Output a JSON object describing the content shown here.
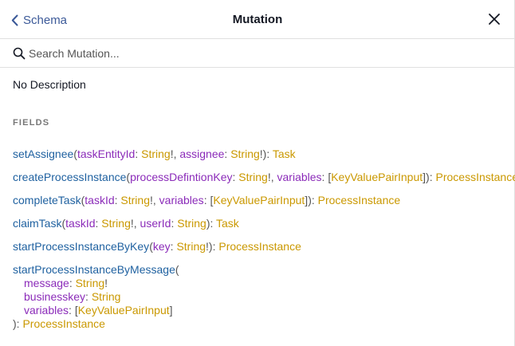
{
  "header": {
    "back_label": "Schema",
    "title": "Mutation"
  },
  "search": {
    "placeholder": "Search Mutation..."
  },
  "description": "No Description",
  "fields_title": "FIELDS",
  "fields": [
    {
      "name": "setAssignee",
      "args": [
        {
          "name": "taskEntityId",
          "type": "String",
          "suffix": "!"
        },
        {
          "name": "assignee",
          "type": "String",
          "suffix": "!"
        }
      ],
      "return_type": "Task"
    },
    {
      "name": "createProcessInstance",
      "args": [
        {
          "name": "processDefintionKey",
          "type": "String",
          "suffix": "!"
        },
        {
          "name": "variables",
          "prefix": "[",
          "type": "KeyValuePairInput",
          "suffix": "]"
        }
      ],
      "return_type": "ProcessInstance"
    },
    {
      "name": "completeTask",
      "args": [
        {
          "name": "taskId",
          "type": "String",
          "suffix": "!"
        },
        {
          "name": "variables",
          "prefix": "[",
          "type": "KeyValuePairInput",
          "suffix": "]"
        }
      ],
      "return_type": "ProcessInstance"
    },
    {
      "name": "claimTask",
      "args": [
        {
          "name": "taskId",
          "type": "String",
          "suffix": "!"
        },
        {
          "name": "userId",
          "type": "String",
          "suffix": ""
        }
      ],
      "return_type": "Task"
    },
    {
      "name": "startProcessInstanceByKey",
      "args": [
        {
          "name": "key",
          "type": "String",
          "suffix": "!"
        }
      ],
      "return_type": "ProcessInstance"
    },
    {
      "name": "startProcessInstanceByMessage",
      "args": [
        {
          "name": "message",
          "type": "String",
          "suffix": "!"
        },
        {
          "name": "businesskey",
          "type": "String",
          "suffix": ""
        },
        {
          "name": "variables",
          "prefix": "[",
          "type": "KeyValuePairInput",
          "suffix": "]"
        }
      ],
      "return_type": "ProcessInstance"
    }
  ]
}
